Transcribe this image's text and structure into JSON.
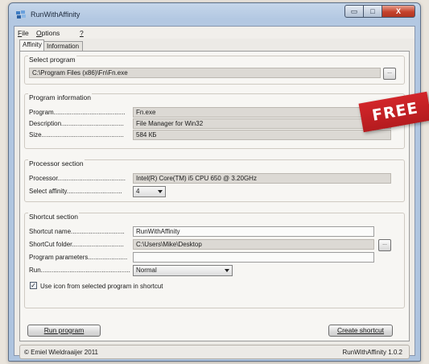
{
  "window": {
    "title": "RunWithAffinity",
    "minimize_glyph": "▭",
    "maximize_glyph": "□",
    "close_glyph": "X"
  },
  "menu": {
    "file": {
      "accel": "F",
      "rest": "ile"
    },
    "options": {
      "accel": "O",
      "rest": "ptions"
    },
    "help": {
      "accel": "?",
      "rest": ""
    }
  },
  "tabs": [
    "Affinity",
    "Information"
  ],
  "select_program": {
    "title": "Select program",
    "path": "C:\\Program Files (x86)\\Fn\\Fn.exe",
    "browse_label": "..."
  },
  "program_info": {
    "title": "Program information",
    "program_label": "Program........................................",
    "program_value": "Fn.exe",
    "description_label": "Description...................................",
    "description_value": "File Manager for Win32",
    "size_label": "Size..............................................",
    "size_value": "584 КБ"
  },
  "processor_section": {
    "title": "Processor section",
    "processor_label": "Processor......................................",
    "processor_value": "Intel(R) Core(TM) i5 CPU 650 @ 3.20GHz",
    "affinity_label": "Select affinity...............................",
    "affinity_value": "4"
  },
  "shortcut_section": {
    "title": "Shortcut section",
    "name_label": "Shortcut name..............................",
    "name_value": "RunWithAffinity",
    "folder_label": "ShortCut folder.............................",
    "folder_value": "C:\\Users\\Mike\\Desktop",
    "folder_browse_label": "...",
    "params_label": "Program parameters......................",
    "params_value": "",
    "run_label": "Run..................................................",
    "run_value": "Normal",
    "use_icon_label": "Use icon from selected program in shortcut",
    "use_icon_checked": true,
    "check_glyph": "✓"
  },
  "buttons": {
    "run_program": "Run program",
    "create_shortcut": "Create shortcut"
  },
  "status": {
    "copyright": "© Emiel Wieldraaijer 2011",
    "version": "RunWithAffinity 1.0.2"
  },
  "badge": {
    "text": "FREE"
  },
  "colors": {
    "badge_red": "#c42226",
    "title_gradient": "#b3c8e2",
    "close_red": "#c5422c"
  }
}
